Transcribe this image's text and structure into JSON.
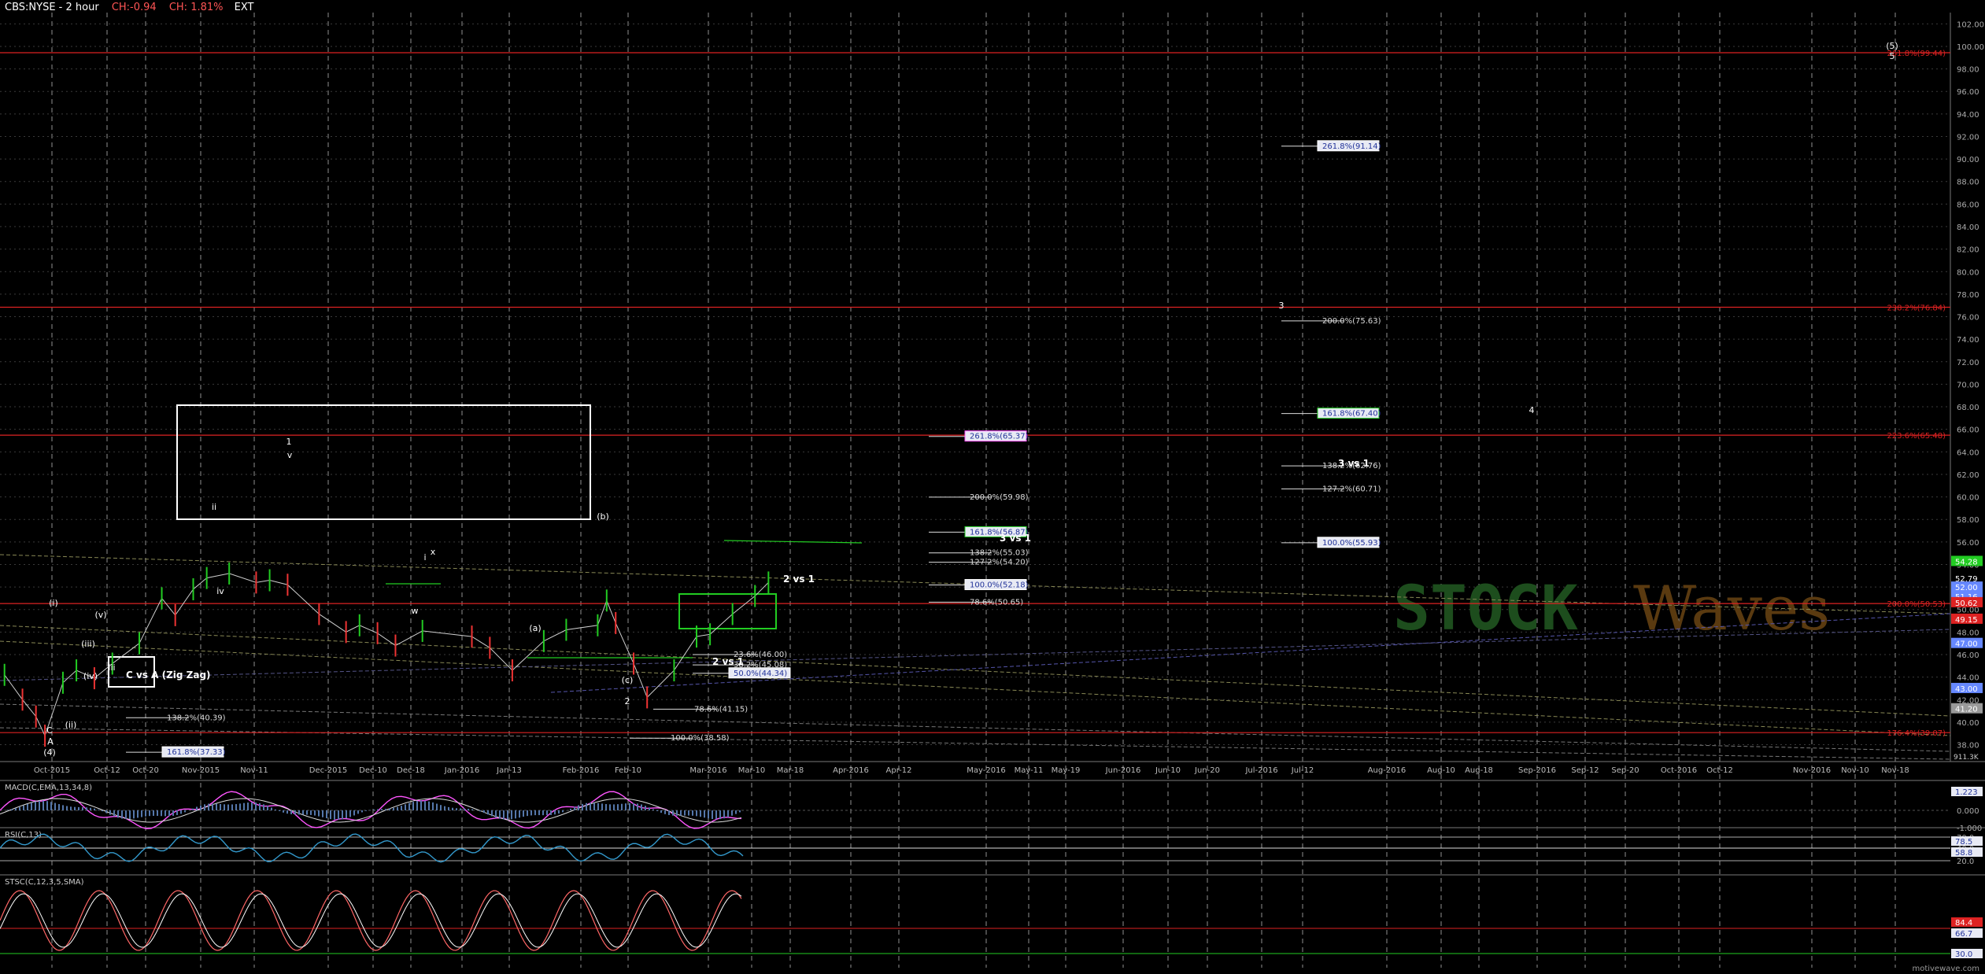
{
  "header": {
    "title": "CBS:NYSE - 2 hour",
    "change1": "CH:-0.94",
    "change2": "CH: 1.81%",
    "ext": "EXT"
  },
  "footer": {
    "watermark": "STOCK Waves",
    "site": "motivewave.com",
    "volume": "911.3K"
  },
  "colors": {
    "background": "#000000",
    "price_up": "#22cc22",
    "price_down": "#ee3333",
    "fib_red": "#dd2222",
    "grid": "#9a9a9a",
    "macd": "#ff55ff",
    "macd_signal": "#dddddd",
    "rsi": "#3399cc",
    "stoch_k": "#ff6666",
    "stoch_d": "#ffffff"
  },
  "chart_data": {
    "type": "line",
    "title": "CBS:NYSE - 2 hour",
    "x_axis": {
      "tick_labels": [
        "Oct-2015",
        "Oct-12",
        "Oct-20",
        "Nov-2015",
        "Nov-11",
        "Dec-2015",
        "Dec-10",
        "Dec-18",
        "Jan-2016",
        "Jan-13",
        "Feb-2016",
        "Feb-10",
        "Mar-2016",
        "Mar-10",
        "Mar-18",
        "Apr-2016",
        "Apr-12",
        "May-2016",
        "May-11",
        "May-19",
        "Jun-2016",
        "Jun-10",
        "Jun-20",
        "Jul-2016",
        "Jul-12",
        "Aug-2016",
        "Aug-10",
        "Aug-18",
        "Sep-2016",
        "Sep-12",
        "Sep-20",
        "Oct-2016",
        "Oct-12",
        "Nov-2016",
        "Nov-10",
        "Nov-18"
      ]
    },
    "y_axis": {
      "ylim": [
        36.5,
        103.0
      ],
      "tick_values": [
        38,
        40,
        42,
        44,
        46,
        48,
        50,
        52,
        54,
        56,
        58,
        60,
        62,
        64,
        66,
        68,
        70,
        72,
        74,
        76,
        78,
        80,
        82,
        84,
        86,
        88,
        90,
        92,
        94,
        96,
        98,
        100,
        102
      ],
      "highlighted_labels": [
        {
          "value": 54.28,
          "text": "54.28",
          "color": "#22cc22"
        },
        {
          "value": 52.79,
          "text": "52.79",
          "color": "#000000"
        },
        {
          "value": 52.0,
          "text": "52.00",
          "color": "#6688ff"
        },
        {
          "value": 51.16,
          "text": "51.16",
          "color": "#6688ff"
        },
        {
          "value": 50.62,
          "text": "50.62",
          "color": "#dd2222"
        },
        {
          "value": 49.15,
          "text": "49.15",
          "color": "#dd2222"
        },
        {
          "value": 47.0,
          "text": "47.00",
          "color": "#6688ff"
        },
        {
          "value": 43.0,
          "text": "43.00",
          "color": "#6688ff"
        },
        {
          "value": 41.2,
          "text": "41.20",
          "color": "#999999"
        }
      ]
    },
    "price_series": {
      "name": "CBS",
      "x": [
        "2015-09-22",
        "2015-09-26",
        "2015-09-29",
        "2015-10-01",
        "2015-10-05",
        "2015-10-08",
        "2015-10-12",
        "2015-10-16",
        "2015-10-22",
        "2015-10-27",
        "2015-10-30",
        "2015-11-03",
        "2015-11-06",
        "2015-11-11",
        "2015-11-17",
        "2015-11-20",
        "2015-11-24",
        "2015-12-01",
        "2015-12-07",
        "2015-12-10",
        "2015-12-14",
        "2015-12-18",
        "2015-12-24",
        "2016-01-04",
        "2016-01-08",
        "2016-01-13",
        "2016-01-20",
        "2016-01-25",
        "2016-02-01",
        "2016-02-03",
        "2016-02-05",
        "2016-02-09",
        "2016-02-12",
        "2016-02-18",
        "2016-02-23",
        "2016-02-26",
        "2016-03-02",
        "2016-03-07",
        "2016-03-10"
      ],
      "values": [
        44.2,
        42.0,
        40.5,
        38.8,
        43.5,
        44.6,
        43.9,
        45.2,
        47.0,
        51.0,
        49.5,
        51.8,
        52.8,
        53.2,
        52.4,
        52.6,
        52.2,
        49.6,
        48.0,
        48.6,
        47.9,
        46.8,
        48.1,
        47.6,
        46.6,
        44.6,
        47.2,
        48.2,
        48.6,
        50.8,
        48.8,
        45.2,
        42.2,
        44.6,
        47.6,
        47.8,
        49.6,
        51.2,
        52.4
      ]
    },
    "fib_horizontals": [
      {
        "value": 99.44,
        "label": "261.8%(99.44)",
        "color": "#dd2222"
      },
      {
        "value": 76.84,
        "label": "238.2%(76.84)",
        "color": "#dd2222"
      },
      {
        "value": 65.48,
        "label": "223.6%(65.48)",
        "color": "#dd2222"
      },
      {
        "value": 50.53,
        "label": "200.0%(50.53)",
        "color": "#dd2222"
      },
      {
        "value": 39.07,
        "label": "176.4%(39.07)",
        "color": "#dd2222"
      }
    ],
    "fib_levels": [
      {
        "value": 91.14,
        "label": "261.8%(91.14)",
        "box": "#ffffff"
      },
      {
        "value": 75.63,
        "label": "200.0%(75.63)",
        "box": null
      },
      {
        "value": 67.4,
        "label": "161.8%(67.40)",
        "box": "#22cc22"
      },
      {
        "value": 62.76,
        "label": "138.2%(62.76)",
        "box": null
      },
      {
        "value": 60.71,
        "label": "127.2%(60.71)",
        "box": null
      },
      {
        "value": 55.93,
        "label": "100.0%(55.93)",
        "box": "#ffffff"
      },
      {
        "value": 65.37,
        "label": "261.8%(65.37)",
        "box": "#ff55ff"
      },
      {
        "value": 59.98,
        "label": "200.0%(59.98)",
        "box": null
      },
      {
        "value": 56.87,
        "label": "161.8%(56.87)",
        "box": "#22cc22"
      },
      {
        "value": 55.03,
        "label": "138.2%(55.03)",
        "box": null
      },
      {
        "value": 54.2,
        "label": "127.2%(54.20)",
        "box": null
      },
      {
        "value": 52.18,
        "label": "100.0%(52.18)",
        "box": "#ffffff"
      },
      {
        "value": 50.65,
        "label": "78.6%(50.65)",
        "box": null
      },
      {
        "value": 46.0,
        "label": "23.6%(46.00)",
        "box": null
      },
      {
        "value": 45.08,
        "label": "38.2%(45.08)",
        "box": null
      },
      {
        "value": 44.34,
        "label": "50.0%(44.34)",
        "box": "#ffffff"
      },
      {
        "value": 41.15,
        "label": "78.6%(41.15)",
        "box": null
      },
      {
        "value": 38.58,
        "label": "100.0%(38.58)",
        "box": null
      },
      {
        "value": 40.39,
        "label": "138.2%(40.39)",
        "box": null
      },
      {
        "value": 37.33,
        "label": "161.8%(37.33)",
        "box": "#ffffff"
      }
    ],
    "wave_labels": [
      "1",
      "(i)",
      "(ii)",
      "(iii)",
      "(iv)",
      "(v)",
      "i",
      "ii",
      "iii",
      "iv",
      "v",
      "w",
      "x",
      "(a)",
      "(b)",
      "(c)",
      "2",
      "3",
      "4",
      "5",
      "(5)",
      "(4)",
      "C",
      "A"
    ],
    "annotations": [
      "C vs A (Zig Zag)",
      "2 vs 1",
      "3 vs 1"
    ],
    "indicators": [
      {
        "name": "MACD(C,EMA,13,34,8)",
        "tick_values": [
          "1.000",
          "0.000",
          "-1.000"
        ],
        "current": "1.223"
      },
      {
        "name": "RSI(C,13)",
        "tick_values": [
          "70.0",
          "40.0",
          "20.0"
        ],
        "current": "78.5",
        "current2": "58.8"
      },
      {
        "name": "STSC(C,12,3,5,SMA)",
        "tick_values": [
          "30.0"
        ],
        "current": "84.4",
        "current2": "66.7"
      }
    ]
  }
}
